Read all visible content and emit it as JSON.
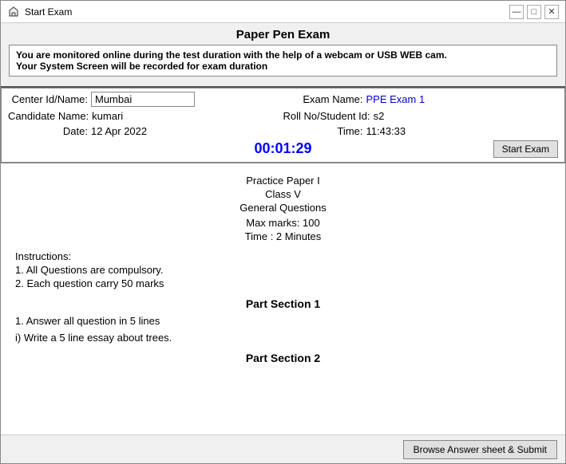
{
  "window": {
    "title": "Start Exam",
    "controls": {
      "minimize": "—",
      "maximize": "□",
      "close": "✕"
    }
  },
  "header": {
    "paper_title": "Paper Pen Exam",
    "monitor_notice_line1": "You are monitored online during the test duration with the help of a webcam or USB WEB cam.",
    "monitor_notice_line2": "Your System Screen will be recorded for exam duration"
  },
  "exam_info": {
    "center_label": "Center Id/Name:",
    "center_value": "Mumbai",
    "exam_name_label": "Exam Name:",
    "exam_name_value": "PPE Exam 1",
    "candidate_label": "Candidate Name:",
    "candidate_value": "kumari",
    "roll_label": "Roll No/Student Id:",
    "roll_value": "s2",
    "date_label": "Date:",
    "date_value": "12 Apr 2022",
    "time_label": "Time:",
    "time_value": "11:43:33",
    "timer_value": "00:01:29",
    "start_exam_label": "Start Exam"
  },
  "content": {
    "practice_title": "Practice Paper I",
    "class_title": "Class V",
    "general_q": "General Questions",
    "max_marks": "Max marks: 100",
    "time_allowed": "Time : 2 Minutes",
    "instructions_title": "Instructions:",
    "instructions": [
      "1. All Questions are compulsory.",
      "2. Each question carry 50 marks"
    ],
    "part1_title": "Part Section 1",
    "part1_instruction": "1. Answer all question in 5 lines",
    "part1_question": "i) Write a 5 line essay about trees.",
    "part2_title": "Part Section 2"
  },
  "footer": {
    "browse_submit_label": "Browse Answer sheet & Submit"
  }
}
